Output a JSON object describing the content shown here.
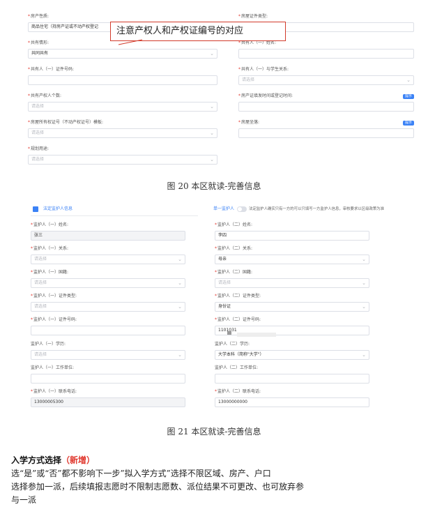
{
  "top_form": {
    "fields": [
      {
        "label": "房产性质:",
        "required": true,
        "value": "商品住宅（持房产证或不动产权登记",
        "placeholder": "",
        "dropdown": false
      },
      {
        "label": "房屋证件类型:",
        "required": true,
        "value": "",
        "placeholder": "",
        "dropdown": false
      },
      {
        "label": "共有情形:",
        "required": true,
        "value": "共同共有",
        "placeholder": "",
        "dropdown": true
      },
      {
        "label": "共有人（一）姓名:",
        "required": true,
        "value": "",
        "placeholder": "",
        "dropdown": false
      },
      {
        "label": "共有人（一）证件号码:",
        "required": true,
        "value": "",
        "placeholder": "",
        "dropdown": false
      },
      {
        "label": "共有人（一）与学生关系:",
        "required": true,
        "value": "",
        "placeholder": "请选择",
        "dropdown": true
      },
      {
        "label": "共有产权人个数:",
        "required": true,
        "value": "",
        "placeholder": "请选择",
        "dropdown": true
      },
      {
        "label": "房产证填发时间或登记时间:",
        "required": true,
        "value": "",
        "placeholder": "",
        "dropdown": false
      },
      {
        "label": "房屋所有权证号（不动产权证号）模板:",
        "required": true,
        "value": "",
        "placeholder": "请选择",
        "dropdown": true
      },
      {
        "label": "房屋坐落:",
        "required": true,
        "value": "",
        "placeholder": "",
        "dropdown": false
      },
      {
        "label": "规划用途:",
        "required": true,
        "value": "",
        "placeholder": "请选择",
        "dropdown": true
      }
    ],
    "chip_label": "提示",
    "callout": "注意产权人和产权证编号的对应"
  },
  "caption_20": "图 20 本区就读-完善信息",
  "guardian_form": {
    "tab_label": "法定监护人信息",
    "switch_label": "单一监护人",
    "switch_note": "法定监护人确实只有一方的可以只填写一方监护人信息，审核要求以区级政策为准",
    "left": [
      {
        "label": "监护人（一）姓名:",
        "required": true,
        "value": "张三",
        "placeholder": "",
        "dropdown": false,
        "gray": true
      },
      {
        "label": "监护人（一）关系:",
        "required": true,
        "value": "",
        "placeholder": "请选择",
        "dropdown": true,
        "gray": false
      },
      {
        "label": "监护人（一）国籍:",
        "required": true,
        "value": "",
        "placeholder": "请选择",
        "dropdown": true,
        "gray": false
      },
      {
        "label": "监护人（一）证件类型:",
        "required": true,
        "value": "",
        "placeholder": "请选择",
        "dropdown": true,
        "gray": false
      },
      {
        "label": "监护人（一）证件号码:",
        "required": true,
        "value": "",
        "placeholder": "",
        "dropdown": false,
        "gray": false
      },
      {
        "label": "监护人（一）学历:",
        "required": false,
        "value": "",
        "placeholder": "请选择",
        "dropdown": true,
        "gray": false
      },
      {
        "label": "监护人（一）工作单位:",
        "required": false,
        "value": "",
        "placeholder": "",
        "dropdown": false,
        "gray": false
      },
      {
        "label": "监护人（一）联系电话:",
        "required": true,
        "value": "13000005300",
        "placeholder": "",
        "dropdown": false,
        "gray": true
      }
    ],
    "right": [
      {
        "label": "监护人（二）姓名:",
        "required": true,
        "value": "李四",
        "placeholder": "",
        "dropdown": false,
        "gray": false
      },
      {
        "label": "监护人（二）关系:",
        "required": true,
        "value": "母亲",
        "placeholder": "",
        "dropdown": true,
        "gray": false
      },
      {
        "label": "监护人（二）国籍:",
        "required": true,
        "value": "",
        "placeholder": "请选择",
        "dropdown": true,
        "gray": false
      },
      {
        "label": "监护人（二）证件类型:",
        "required": true,
        "value": "身份证",
        "placeholder": "",
        "dropdown": true,
        "gray": false
      },
      {
        "label": "监护人（二）证件号码:",
        "required": true,
        "value": "1101031",
        "placeholder": "",
        "dropdown": false,
        "gray": false
      },
      {
        "label": "监护人（二）学历:",
        "required": false,
        "value": "大学本科（简称\"大学\"）",
        "placeholder": "",
        "dropdown": true,
        "gray": false
      },
      {
        "label": "监护人（二）工作单位:",
        "required": false,
        "value": "",
        "placeholder": "",
        "dropdown": false,
        "gray": false
      },
      {
        "label": "监护人（二）联系电话:",
        "required": true,
        "value": "13000000000",
        "placeholder": "",
        "dropdown": false,
        "gray": false
      }
    ]
  },
  "caption_21": "图 21 本区就读-完善信息",
  "section": {
    "title": "入学方式选择",
    "title_tag": "（新增）",
    "lines": [
      "选“是”或“否”都不影响下一步”拟入学方式”选择不限区域、房产、户口",
      "选择参加一派，后续填报志愿时不限制志愿数、派位结果不可更改、也可放弃参",
      "与一派"
    ]
  }
}
